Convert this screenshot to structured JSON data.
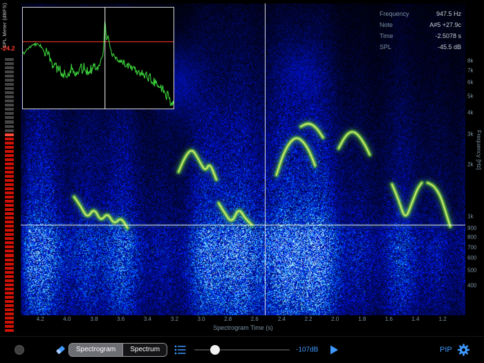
{
  "spl_meter": {
    "label": "SPL Meter (dBFS)",
    "peak_value": "-24.2",
    "segment_count": 66,
    "gray_count": 18,
    "colors": {
      "inactive": "#454545",
      "active": "#cf1205",
      "peak": "#ff4a38",
      "value_text": "#ff3b30"
    }
  },
  "readout": {
    "rows": [
      {
        "label": "Frequency",
        "value": "947.5 Hz"
      },
      {
        "label": "Note",
        "value": "A#5 +27.9c"
      },
      {
        "label": "Time",
        "value": "-2.5078 s"
      },
      {
        "label": "SPL",
        "value": "-45.5 dB"
      }
    ]
  },
  "crosshair": {
    "x_pct": 54.9,
    "y_pct": 71.0,
    "color": "#ffffff"
  },
  "time_axis": {
    "title": "Spectrogram Time (s)",
    "ticks": [
      {
        "label": "4.2",
        "x_pct": 4.4
      },
      {
        "label": "4.0",
        "x_pct": 10.4
      },
      {
        "label": "3.8",
        "x_pct": 16.5
      },
      {
        "label": "3.6",
        "x_pct": 22.5
      },
      {
        "label": "3.4",
        "x_pct": 28.5
      },
      {
        "label": "3.2",
        "x_pct": 34.6
      },
      {
        "label": "3.0",
        "x_pct": 40.6
      },
      {
        "label": "2.8",
        "x_pct": 46.6
      },
      {
        "label": "2.6",
        "x_pct": 52.6
      },
      {
        "label": "2.4",
        "x_pct": 58.7
      },
      {
        "label": "2.2",
        "x_pct": 64.7
      },
      {
        "label": "2.0",
        "x_pct": 70.7
      },
      {
        "label": "1.8",
        "x_pct": 76.8
      },
      {
        "label": "1.6",
        "x_pct": 82.8
      },
      {
        "label": "1.4",
        "x_pct": 88.8
      },
      {
        "label": "1.2",
        "x_pct": 94.9
      }
    ]
  },
  "freq_axis": {
    "title": "Frequency [Hz]",
    "ticks": [
      {
        "label": "8k",
        "y_pct": 18.4
      },
      {
        "label": "7k",
        "y_pct": 21.5
      },
      {
        "label": "6k",
        "y_pct": 25.3
      },
      {
        "label": "5k",
        "y_pct": 29.7
      },
      {
        "label": "4k",
        "y_pct": 35.0
      },
      {
        "label": "3k",
        "y_pct": 41.9
      },
      {
        "label": "2k",
        "y_pct": 51.7
      },
      {
        "label": "1k",
        "y_pct": 68.3
      },
      {
        "label": "900",
        "y_pct": 72.0
      },
      {
        "label": "800",
        "y_pct": 75.0
      },
      {
        "label": "700",
        "y_pct": 78.2
      },
      {
        "label": "600",
        "y_pct": 81.6
      },
      {
        "label": "500",
        "y_pct": 85.6
      },
      {
        "label": "400",
        "y_pct": 90.4
      }
    ]
  },
  "inset": {
    "threshold_line_y_pct": 33.8,
    "threshold_color": "#ff3b30",
    "cursor_x_pct": 54.5,
    "cursor_color": "#ffffff",
    "trace_color": "#3cd63c",
    "keypoints": [
      [
        0,
        46
      ],
      [
        4,
        40
      ],
      [
        8,
        36
      ],
      [
        12,
        38
      ],
      [
        16,
        46
      ],
      [
        20,
        56
      ],
      [
        24,
        62
      ],
      [
        28,
        66
      ],
      [
        32,
        61
      ],
      [
        36,
        64
      ],
      [
        40,
        60
      ],
      [
        44,
        62
      ],
      [
        48,
        58
      ],
      [
        51,
        56
      ],
      [
        53.5,
        44
      ],
      [
        54.5,
        10
      ],
      [
        55.5,
        34
      ],
      [
        56.5,
        28
      ],
      [
        58,
        42
      ],
      [
        60,
        48
      ],
      [
        64,
        52
      ],
      [
        68,
        56
      ],
      [
        72,
        58
      ],
      [
        76,
        62
      ],
      [
        80,
        66
      ],
      [
        85,
        70
      ],
      [
        90,
        76
      ],
      [
        95,
        85
      ],
      [
        98,
        92
      ],
      [
        100,
        96
      ]
    ]
  },
  "spectrogram": {
    "palette": {
      "low": "#000010",
      "mid": "#0030c0",
      "high": "#40e040",
      "peak": "#d8f060"
    },
    "traces": [
      {
        "points": [
          [
            12,
            62
          ],
          [
            13.5,
            65
          ],
          [
            15,
            69
          ],
          [
            16.5,
            65.5
          ],
          [
            18,
            70
          ],
          [
            19.5,
            67
          ],
          [
            21,
            71
          ],
          [
            22.5,
            68.5
          ],
          [
            24,
            72
          ]
        ]
      },
      {
        "points": [
          [
            35.5,
            54
          ],
          [
            37,
            49
          ],
          [
            38.5,
            46.5
          ],
          [
            40,
            50
          ],
          [
            41.5,
            54
          ],
          [
            42.5,
            51
          ],
          [
            44,
            56.5
          ]
        ]
      },
      {
        "points": [
          [
            44.5,
            64
          ],
          [
            46,
            67.5
          ],
          [
            47.5,
            70.5
          ],
          [
            49,
            65.5
          ],
          [
            50.5,
            69
          ],
          [
            52,
            71
          ]
        ]
      },
      {
        "points": [
          [
            57.5,
            55
          ],
          [
            59,
            48.5
          ],
          [
            60.5,
            44.5
          ],
          [
            62,
            42.8
          ],
          [
            63.5,
            44.2
          ],
          [
            65,
            47.5
          ],
          [
            66.2,
            52
          ]
        ]
      },
      {
        "points": [
          [
            63,
            39.5
          ],
          [
            64.8,
            38.2
          ],
          [
            66.5,
            39.8
          ],
          [
            68,
            43
          ]
        ]
      },
      {
        "points": [
          [
            71.5,
            46.5
          ],
          [
            73,
            42.5
          ],
          [
            74.5,
            40.8
          ],
          [
            76,
            42.2
          ],
          [
            77.5,
            45.5
          ],
          [
            78.5,
            48.5
          ]
        ]
      },
      {
        "points": [
          [
            83.5,
            58
          ],
          [
            85,
            63
          ],
          [
            86.5,
            69.5
          ],
          [
            88,
            64
          ],
          [
            89.2,
            59.5
          ],
          [
            90.2,
            57.5
          ]
        ]
      },
      {
        "points": [
          [
            91.5,
            57.5
          ],
          [
            93,
            58.5
          ],
          [
            94.5,
            62
          ],
          [
            95.6,
            67
          ],
          [
            96.6,
            71.5
          ]
        ]
      }
    ]
  },
  "toolbar": {
    "segments": [
      {
        "label": "Spectrogram",
        "selected": true
      },
      {
        "label": "Spectrum",
        "selected": false
      }
    ],
    "slider_value": "-107dB",
    "slider_pct": 22,
    "pip_label": "PIP",
    "icon_color": "#3f9aff"
  }
}
